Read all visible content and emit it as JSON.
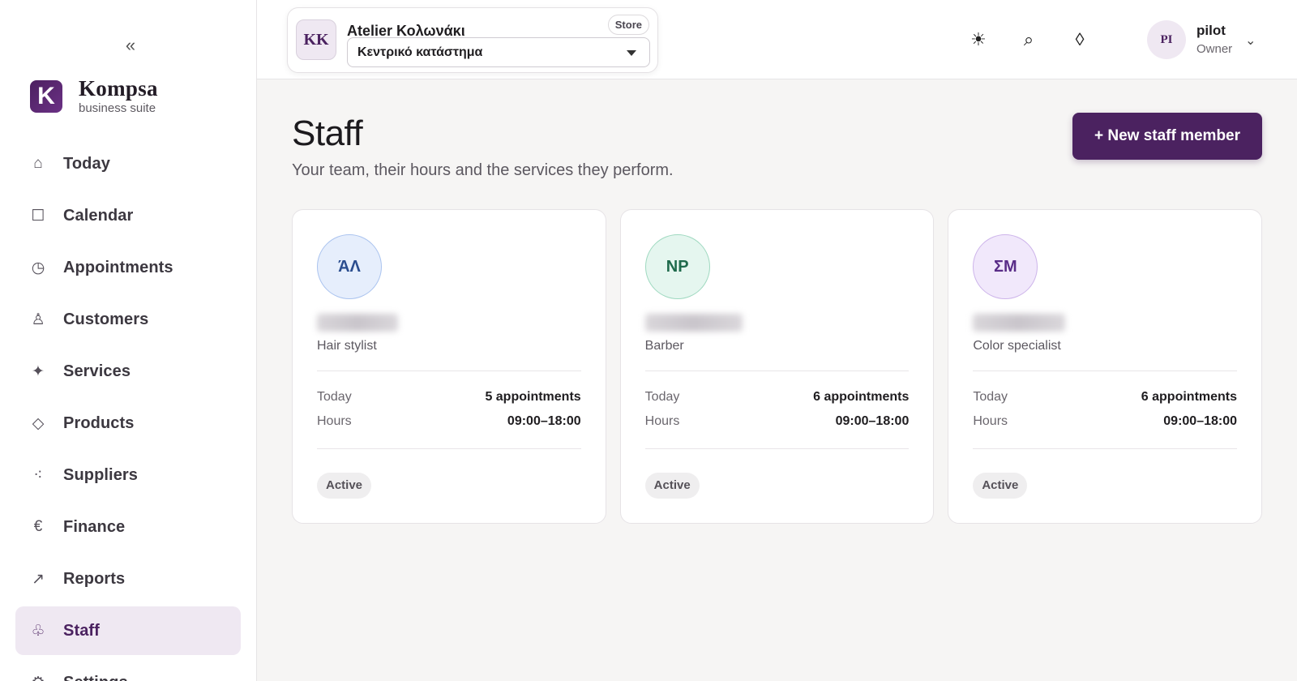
{
  "sidebar": {
    "collapse_glyph": "«",
    "brand": {
      "logo_letter": "K",
      "name": "Kompsa",
      "subtitle": "business suite"
    },
    "items": [
      {
        "label": "Today",
        "icon": "home-icon",
        "glyph": "⌂",
        "active": false
      },
      {
        "label": "Calendar",
        "icon": "calendar-icon",
        "glyph": "☐",
        "active": false
      },
      {
        "label": "Appointments",
        "icon": "clock-icon",
        "glyph": "◷",
        "active": false
      },
      {
        "label": "Customers",
        "icon": "person-icon",
        "glyph": "♙",
        "active": false
      },
      {
        "label": "Services",
        "icon": "sparkle-icon",
        "glyph": "✦",
        "active": false
      },
      {
        "label": "Products",
        "icon": "diamond-icon",
        "glyph": "◇",
        "active": false
      },
      {
        "label": "Suppliers",
        "icon": "nodes-icon",
        "glyph": "⁖",
        "active": false
      },
      {
        "label": "Finance",
        "icon": "euro-icon",
        "glyph": "€",
        "active": false
      },
      {
        "label": "Reports",
        "icon": "arrow-up-right-icon",
        "glyph": "↗",
        "active": false
      },
      {
        "label": "Staff",
        "icon": "staff-icon",
        "glyph": "♧",
        "active": true
      },
      {
        "label": "Settings",
        "icon": "gear-icon",
        "glyph": "⚙",
        "active": false
      }
    ]
  },
  "topbar": {
    "store": {
      "badge": "KK",
      "name": "Atelier Κολωνάκι",
      "tag": "Store",
      "selected_location": "Κεντρικό κατάστημα"
    },
    "icons": [
      {
        "name": "theme-toggle-icon",
        "glyph": "☀"
      },
      {
        "name": "search-icon",
        "glyph": "⌕"
      },
      {
        "name": "diamond-icon",
        "glyph": "◊"
      }
    ],
    "user": {
      "initials": "PI",
      "name": "pilot",
      "role": "Owner",
      "chevron": "⌄"
    }
  },
  "main": {
    "title": "Staff",
    "subtitle": "Your team, their hours and the services they perform.",
    "new_button": "+ New staff member",
    "today_label": "Today",
    "hours_label": "Hours",
    "staff": [
      {
        "initials": "ΆΛ",
        "role": "Hair stylist",
        "today": "5 appointments",
        "hours": "09:00–18:00",
        "status": "Active",
        "avatar_bg": "#e6eefc",
        "avatar_border": "#aac3ef",
        "avatar_color": "#2b4d8f"
      },
      {
        "initials": "ΝΡ",
        "role": "Barber",
        "today": "6 appointments",
        "hours": "09:00–18:00",
        "status": "Active",
        "avatar_bg": "#e5f6ef",
        "avatar_border": "#9fd9c0",
        "avatar_color": "#1f6a4c"
      },
      {
        "initials": "ΣΜ",
        "role": "Color specialist",
        "today": "6 appointments",
        "hours": "09:00–18:00",
        "status": "Active",
        "avatar_bg": "#f1e8fb",
        "avatar_border": "#cdb4ea",
        "avatar_color": "#5a2d88"
      }
    ]
  }
}
